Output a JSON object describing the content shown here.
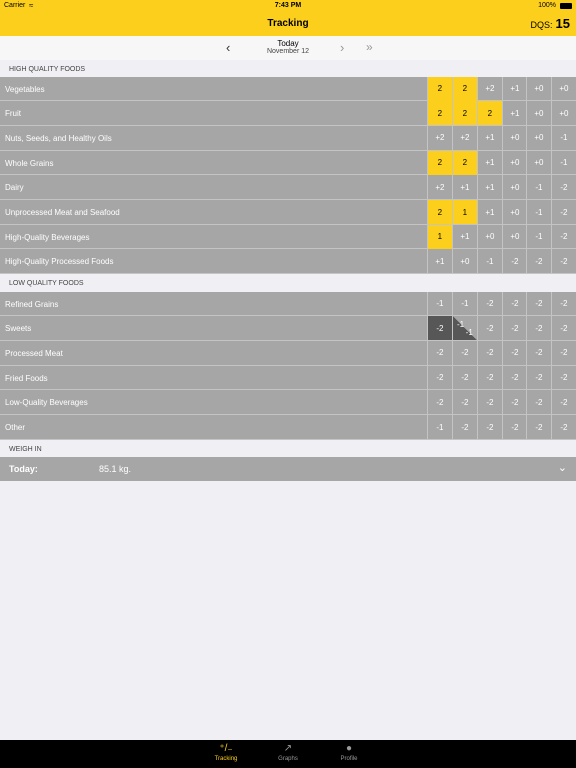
{
  "status_bar": {
    "carrier": "Carrier",
    "time": "7:43 PM",
    "battery": "100%"
  },
  "nav": {
    "title": "Tracking",
    "dqs_label": "DQS:",
    "dqs_value": "15"
  },
  "date_nav": {
    "today": "Today",
    "date": "November 12"
  },
  "sections": {
    "high": "HIGH QUALITY FOODS",
    "low": "LOW QUALITY FOODS",
    "weigh": "WEIGH IN"
  },
  "high_rows": [
    {
      "label": "Vegetables",
      "cells": [
        "2",
        "2",
        "+2",
        "+1",
        "+0",
        "+0"
      ],
      "filled": 2
    },
    {
      "label": "Fruit",
      "cells": [
        "2",
        "2",
        "2",
        "+1",
        "+0",
        "+0"
      ],
      "filled": 3
    },
    {
      "label": "Nuts, Seeds, and Healthy Oils",
      "cells": [
        "+2",
        "+2",
        "+1",
        "+0",
        "+0",
        "-1"
      ],
      "filled": 0
    },
    {
      "label": "Whole Grains",
      "cells": [
        "2",
        "2",
        "+1",
        "+0",
        "+0",
        "-1"
      ],
      "filled": 2
    },
    {
      "label": "Dairy",
      "cells": [
        "+2",
        "+1",
        "+1",
        "+0",
        "-1",
        "-2"
      ],
      "filled": 0
    },
    {
      "label": "Unprocessed Meat and Seafood",
      "cells": [
        "2",
        "1",
        "+1",
        "+0",
        "-1",
        "-2"
      ],
      "filled": 2
    },
    {
      "label": "High-Quality Beverages",
      "cells": [
        "1",
        "+1",
        "+0",
        "+0",
        "-1",
        "-2"
      ],
      "filled": 1
    },
    {
      "label": "High-Quality Processed Foods",
      "cells": [
        "+1",
        "+0",
        "-1",
        "-2",
        "-2",
        "-2"
      ],
      "filled": 0
    }
  ],
  "low_rows": [
    {
      "label": "Refined Grains",
      "cells": [
        "-1",
        "-1",
        "-2",
        "-2",
        "-2",
        "-2"
      ]
    },
    {
      "label": "Sweets",
      "cells": [
        "-2",
        "-1",
        "-2",
        "-2",
        "-2",
        "-2"
      ],
      "split_sub": "-1"
    },
    {
      "label": "Processed Meat",
      "cells": [
        "-2",
        "-2",
        "-2",
        "-2",
        "-2",
        "-2"
      ]
    },
    {
      "label": "Fried Foods",
      "cells": [
        "-2",
        "-2",
        "-2",
        "-2",
        "-2",
        "-2"
      ]
    },
    {
      "label": "Low-Quality Beverages",
      "cells": [
        "-2",
        "-2",
        "-2",
        "-2",
        "-2",
        "-2"
      ]
    },
    {
      "label": "Other",
      "cells": [
        "-1",
        "-2",
        "-2",
        "-2",
        "-2",
        "-2"
      ]
    }
  ],
  "weigh_in": {
    "label": "Today:",
    "value": "85.1 kg."
  },
  "tabs": [
    {
      "label": "Tracking",
      "icon": "plus-minus-icon"
    },
    {
      "label": "Graphs",
      "icon": "graph-icon"
    },
    {
      "label": "Profile",
      "icon": "profile-icon"
    }
  ],
  "colors": {
    "accent": "#fdcf1d",
    "row": "#a6a6a6",
    "dark_cell": "#575757"
  }
}
